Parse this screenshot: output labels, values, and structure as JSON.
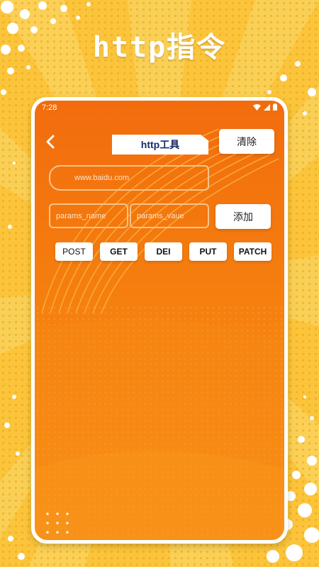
{
  "promo": {
    "title": "http指令"
  },
  "status_bar": {
    "time": "7:28",
    "icons": [
      "wifi-icon",
      "signal-icon",
      "battery-icon"
    ]
  },
  "header": {
    "back_icon": "chevron-left-icon",
    "title": "http工具",
    "clear_label": "清除"
  },
  "form": {
    "url_placeholder": "www.baidu.com",
    "param_name_placeholder": "params_name",
    "param_value_placeholder": "params_vaue",
    "add_label": "添加"
  },
  "methods": [
    "POST",
    "GET",
    "DEI",
    "PUT",
    "PATCH"
  ],
  "colors": {
    "background": "#f7b52a",
    "screen_orange": "#f26c0e",
    "title_navy": "#1a2a6c"
  }
}
